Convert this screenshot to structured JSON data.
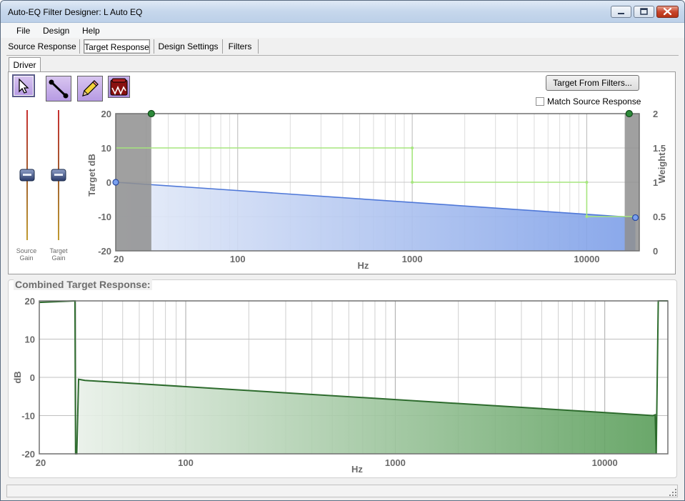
{
  "window": {
    "title": "Auto-EQ Filter Designer: L Auto EQ"
  },
  "menu": [
    "File",
    "Design",
    "Help"
  ],
  "tabs": [
    {
      "label": "Source Response",
      "selected": false
    },
    {
      "label": "Target Response",
      "selected": true
    },
    {
      "label": "Design Settings",
      "selected": false
    },
    {
      "label": "Filters",
      "selected": false
    }
  ],
  "subtab": {
    "label": "Driver"
  },
  "tools": [
    {
      "name": "select-tool",
      "icon": "arrow-cursor-icon",
      "selected": true
    },
    {
      "name": "line-tool",
      "icon": "line-segment-icon",
      "selected": false
    },
    {
      "name": "pencil-tool",
      "icon": "pencil-icon",
      "selected": false
    },
    {
      "name": "house-curve-tool",
      "icon": "speaker-curve-icon",
      "selected": false
    }
  ],
  "buttons": {
    "target_from_filters": "Target From Filters..."
  },
  "checkbox": {
    "match_source": "Match Source Response",
    "checked": false
  },
  "sliders": {
    "source_gain": "Source Gain",
    "target_gain": "Target Gain"
  },
  "colors": {
    "target_fill": "#7c9ee8",
    "weight_line": "#a6e67e",
    "combined_line": "#2d6b2d",
    "combined_fill": "#5a9e5a"
  },
  "target_chart": {
    "type": "line",
    "xlabel": "Hz",
    "ylabel": "Target dB",
    "y2label": "Weight",
    "xscale": "log",
    "xlim": [
      20,
      20000
    ],
    "ylim": [
      -20,
      20
    ],
    "y2lim": [
      0,
      2
    ],
    "x_ticks": [
      "20",
      "100",
      "1000",
      "10000"
    ],
    "y_ticks": [
      "20",
      "10",
      "0",
      "-10",
      "-20"
    ],
    "y2_ticks": [
      "2",
      "1.5",
      "1",
      "0.5",
      "0"
    ],
    "excluded_bands": [
      [
        20,
        32
      ],
      [
        16500,
        20000
      ]
    ],
    "series": [
      {
        "name": "Target dB",
        "points": [
          [
            20,
            0
          ],
          [
            19000,
            -10.3
          ]
        ]
      },
      {
        "name": "Weight",
        "points": [
          [
            20,
            1.5
          ],
          [
            1000,
            1.5
          ],
          [
            1000,
            1.0
          ],
          [
            10000,
            1.0
          ],
          [
            10000,
            0.5
          ],
          [
            19000,
            0.5
          ]
        ]
      }
    ],
    "weight_handles": [
      [
        32,
        2
      ],
      [
        17500,
        2
      ]
    ]
  },
  "combined_chart": {
    "title": "Combined Target Response:",
    "type": "line",
    "xlabel": "Hz",
    "ylabel": "dB",
    "xscale": "log",
    "xlim": [
      20,
      20000
    ],
    "ylim": [
      -20,
      20
    ],
    "x_ticks": [
      "20",
      "100",
      "1000",
      "10000"
    ],
    "y_ticks": [
      "20",
      "10",
      "0",
      "-10",
      "-20"
    ],
    "series": [
      {
        "name": "Combined",
        "points": [
          [
            20,
            19.6
          ],
          [
            29.6,
            20
          ],
          [
            29.8,
            -20
          ],
          [
            30.2,
            -20
          ],
          [
            30.8,
            -0.5
          ],
          [
            33,
            -0.8
          ],
          [
            10000,
            -9.2
          ],
          [
            17000,
            -10
          ],
          [
            17400,
            -9.8
          ],
          [
            17600,
            -20
          ],
          [
            18000,
            20
          ],
          [
            20000,
            20
          ]
        ]
      }
    ]
  }
}
